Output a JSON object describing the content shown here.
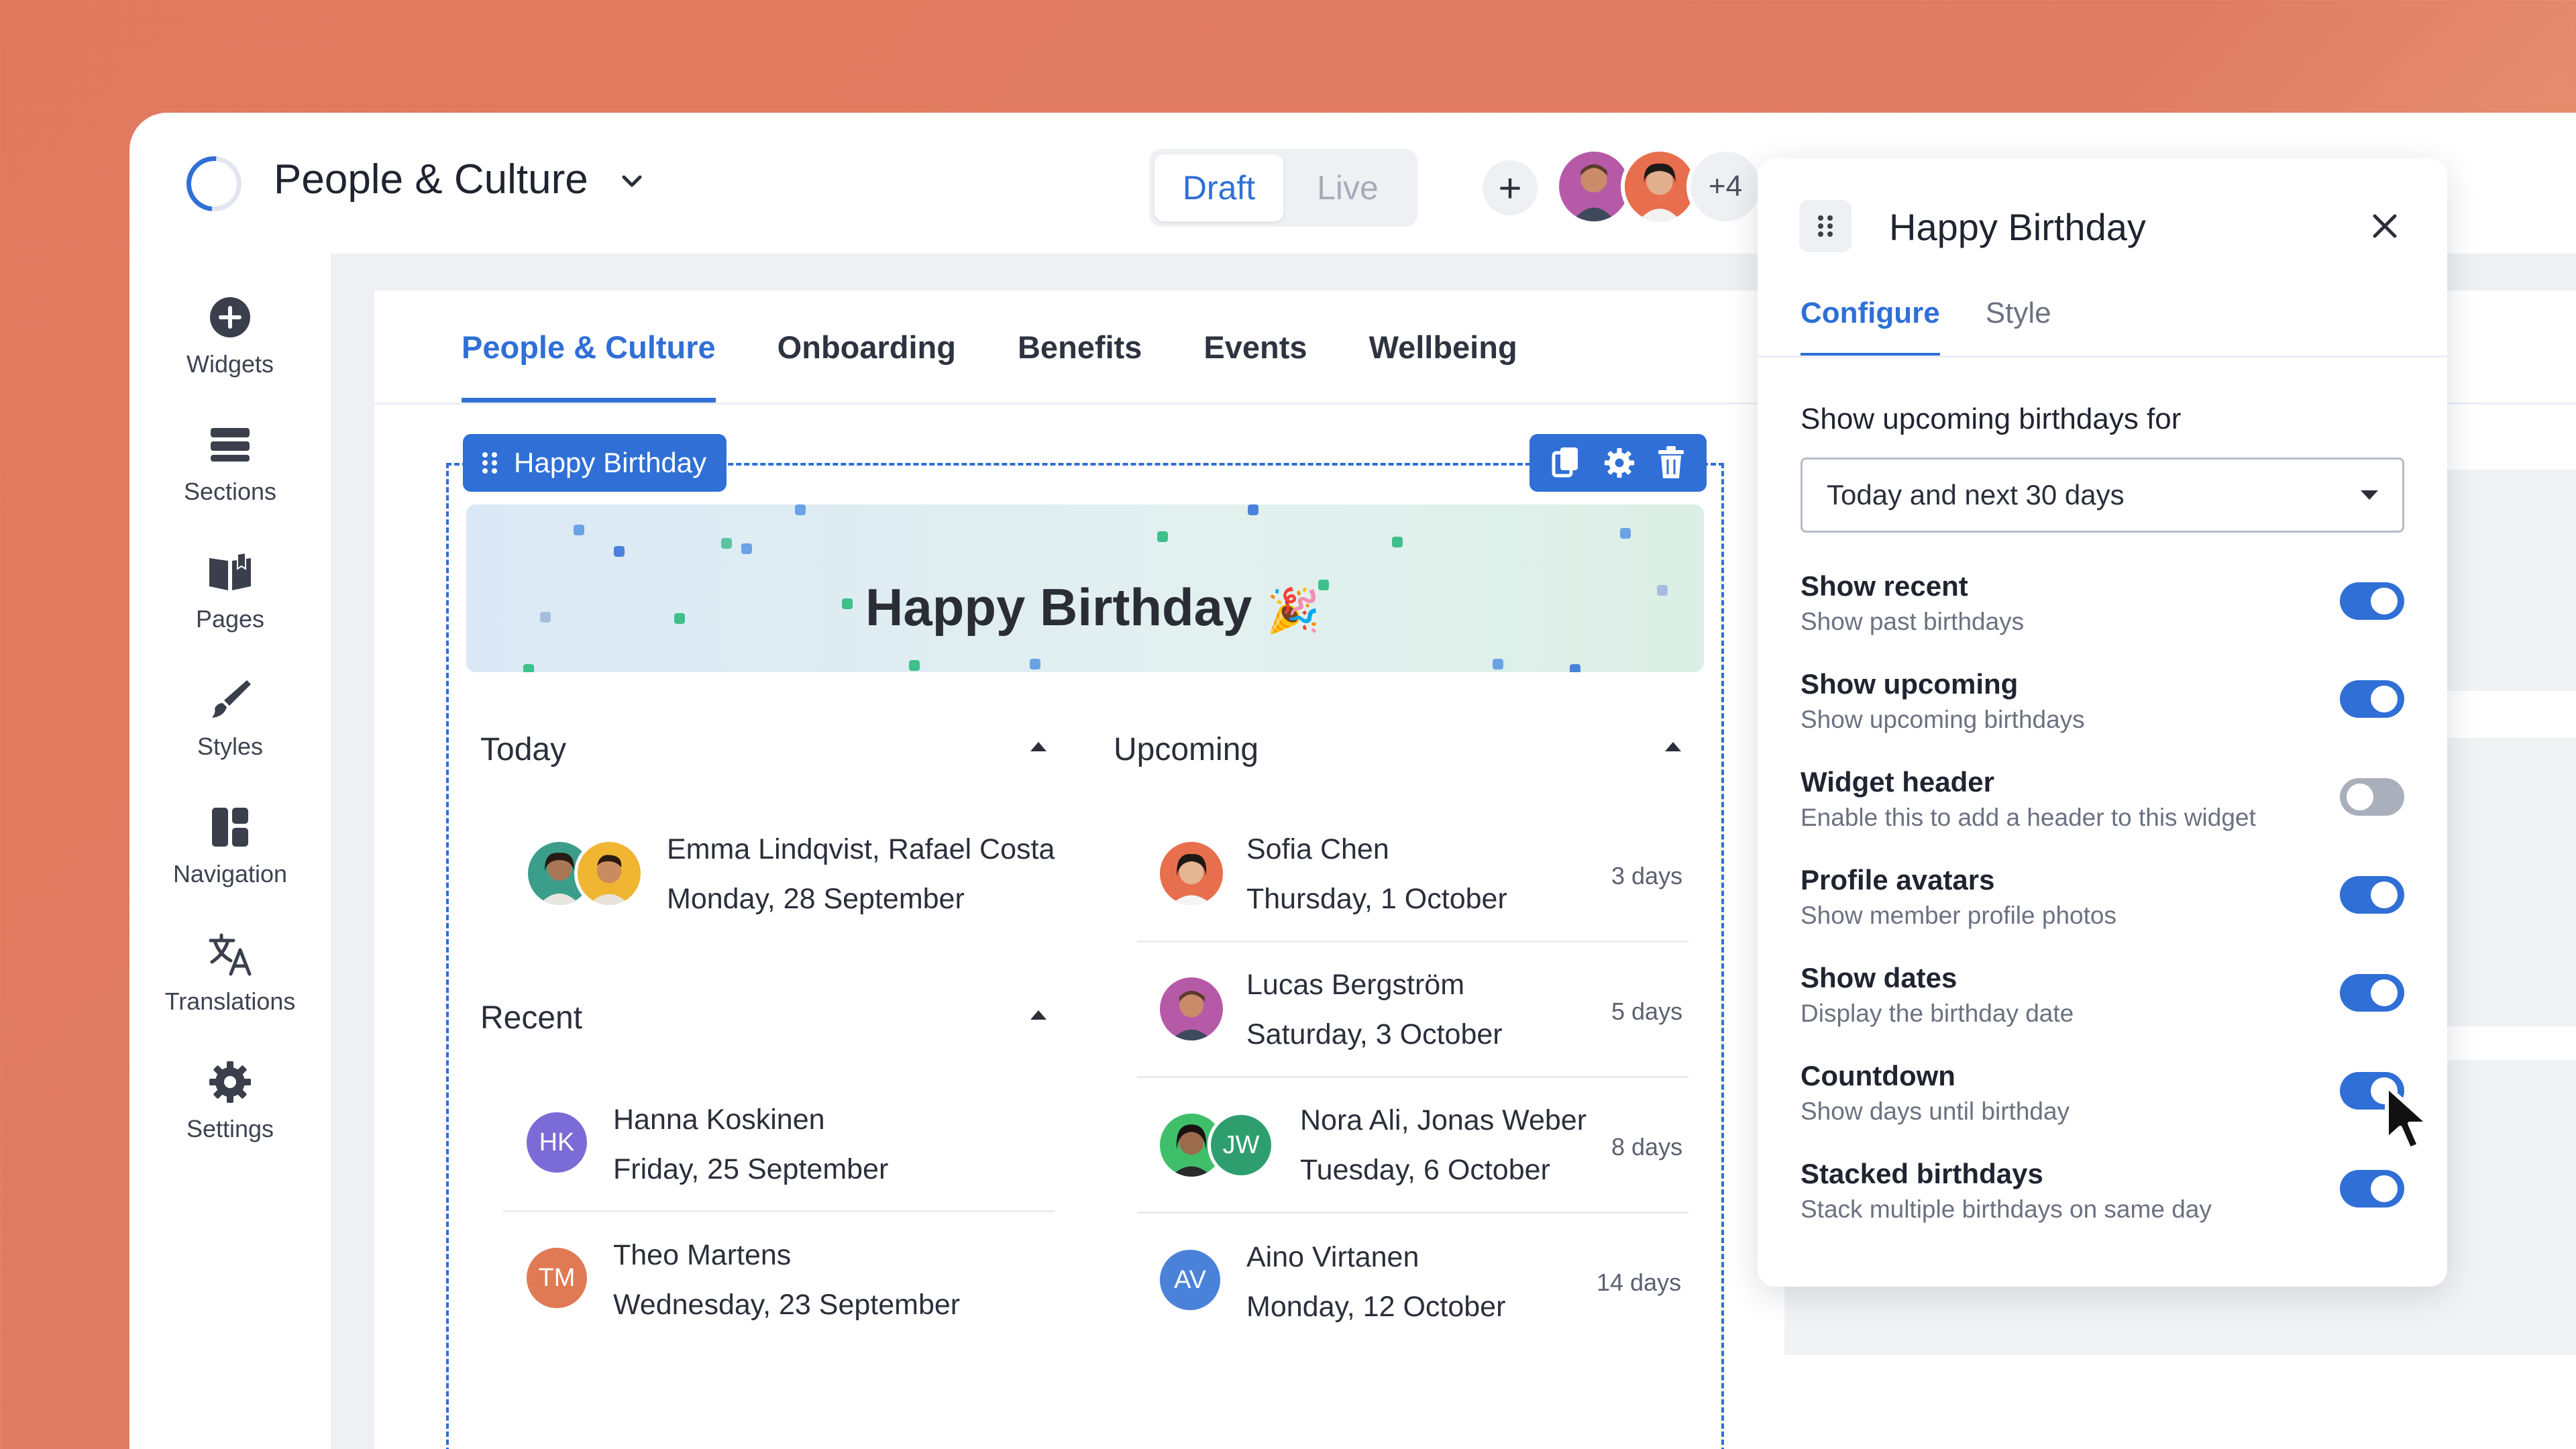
{
  "app": {
    "title": "People & Culture",
    "mode_draft": "Draft",
    "mode_live": "Live",
    "collaborators_more": "+4"
  },
  "sidebar": {
    "items": [
      {
        "label": "Widgets",
        "icon": "plus-circle-icon"
      },
      {
        "label": "Sections",
        "icon": "sections-icon"
      },
      {
        "label": "Pages",
        "icon": "book-icon"
      },
      {
        "label": "Styles",
        "icon": "brush-icon"
      },
      {
        "label": "Navigation",
        "icon": "layout-icon"
      },
      {
        "label": "Translations",
        "icon": "translate-icon"
      },
      {
        "label": "Settings",
        "icon": "gear-icon"
      }
    ]
  },
  "tabs": [
    {
      "label": "People & Culture",
      "active": true
    },
    {
      "label": "Onboarding",
      "active": false
    },
    {
      "label": "Benefits",
      "active": false
    },
    {
      "label": "Events",
      "active": false
    },
    {
      "label": "Wellbeing",
      "active": false
    }
  ],
  "widget": {
    "chip_label": "Happy Birthday",
    "banner_title": "Happy Birthday",
    "banner_emoji": "🎉",
    "today": {
      "title": "Today",
      "entries": [
        {
          "names": "Emma Lindqvist, Rafael Costa",
          "date": "Monday, 28 September"
        }
      ]
    },
    "recent": {
      "title": "Recent",
      "entries": [
        {
          "initials": "HK",
          "name": "Hanna Koskinen",
          "date": "Friday, 25 September",
          "color": "#7b6bd6"
        },
        {
          "initials": "TM",
          "name": "Theo Martens",
          "date": "Wednesday, 23 September",
          "color": "#e07a55"
        }
      ]
    },
    "upcoming": {
      "title": "Upcoming",
      "entries": [
        {
          "name": "Sofia Chen",
          "date": "Thursday, 1 October",
          "days": "3 days"
        },
        {
          "name": "Lucas Bergström",
          "date": "Saturday, 3 October",
          "days": "5 days"
        },
        {
          "name": "Nora Ali, Jonas Weber",
          "date": "Tuesday, 6 October",
          "days": "8 days",
          "initials": "JW",
          "color": "#2f9e6e"
        },
        {
          "name": "Aino Virtanen",
          "date": "Monday, 12 October",
          "days": "14 days",
          "initials": "AV",
          "color": "#4a82d9"
        }
      ]
    }
  },
  "panel": {
    "title": "Happy Birthday",
    "tabs": {
      "configure": "Configure",
      "style": "Style"
    },
    "field_label": "Show upcoming birthdays for",
    "select_value": "Today and next 30 days",
    "options": [
      {
        "title": "Show recent",
        "desc": "Show past birthdays",
        "on": true
      },
      {
        "title": "Show upcoming",
        "desc": "Show upcoming birthdays",
        "on": true
      },
      {
        "title": "Widget header",
        "desc": "Enable this to add a header to this widget",
        "on": false
      },
      {
        "title": "Profile avatars",
        "desc": "Show member profile photos",
        "on": true
      },
      {
        "title": "Show dates",
        "desc": "Display the birthday date",
        "on": true
      },
      {
        "title": "Countdown",
        "desc": "Show days until birthday",
        "on": true
      },
      {
        "title": "Stacked birthdays",
        "desc": "Stack multiple birthdays on same day",
        "on": true
      }
    ]
  },
  "colors": {
    "accent": "#2f6fd6",
    "background_gradient_start": "#e07a5f",
    "background_gradient_end": "#f6c49e"
  }
}
